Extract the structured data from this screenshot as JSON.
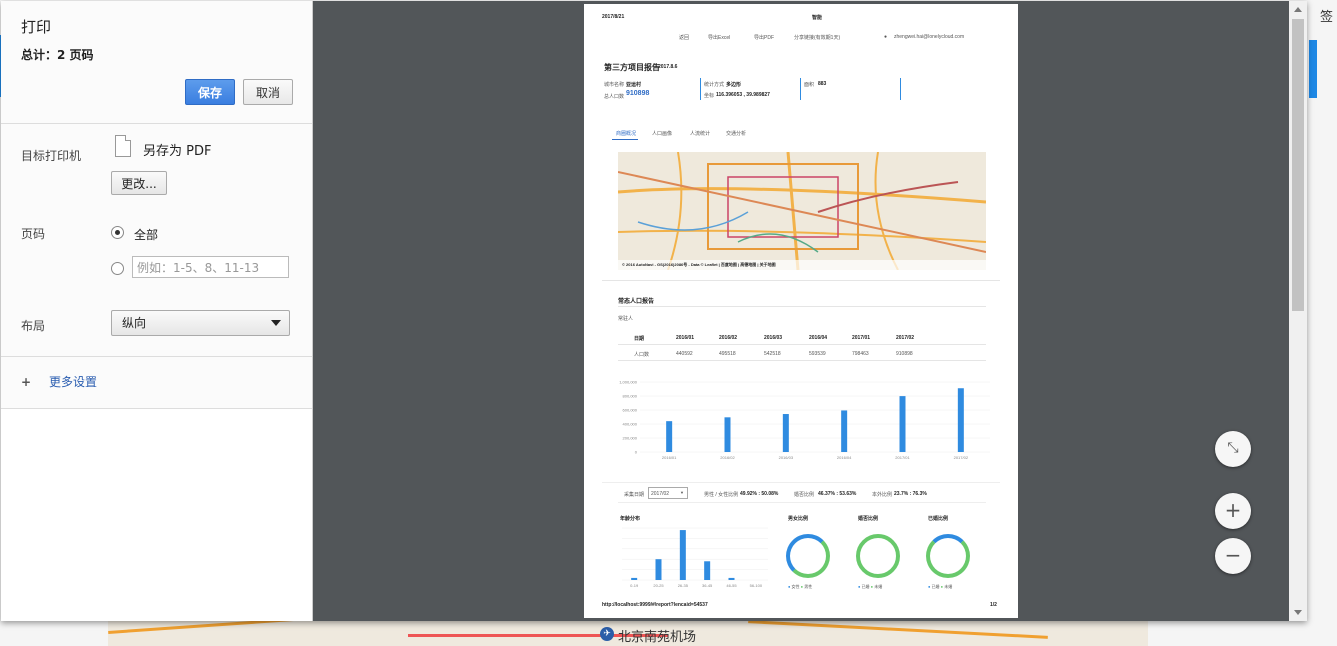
{
  "background": {
    "map_label": "北京南苑机场",
    "right_text": "签"
  },
  "dialog": {
    "title": "打印",
    "summary": "总计：2 页码",
    "save_label": "保存",
    "cancel_label": "取消",
    "destination_label": "目标打印机",
    "destination_value": "另存为 PDF",
    "change_label": "更改...",
    "pages_label": "页码",
    "pages_all": "全部",
    "pages_placeholder": "例如：1-5、8、11-13",
    "layout_label": "布局",
    "layout_value": "纵向",
    "more_settings": "更多设置"
  },
  "preview": {
    "header_date": "2017/8/21",
    "header_center": "智能",
    "nav": [
      "返回",
      "导出Excel",
      "导出PDF",
      "分享链接(有效期1天)"
    ],
    "user": "zhengwei.hai@lonelycloud.com",
    "report_title": "第三方项目报告",
    "report_date": "2017.8.6",
    "info": {
      "city_label": "城市名称",
      "city_value": "亚运村",
      "method_label": "统计方式",
      "method_value": "多边形",
      "area_label": "面积",
      "area_value": "883",
      "population_label": "总人口数",
      "population_value": "910898",
      "coords_label": "坐标",
      "coords_value": "116.396053 , 39.989827"
    },
    "tabs": [
      "商圈概况",
      "人口画像",
      "人流统计",
      "交通分析"
    ],
    "map_credit": "© 2016 AutoNavi - GS(2016)2086号 - Data © Leaflet | 百度地图 | 高德地图 | 关于地图",
    "section_title": "常态人口报告",
    "subsection": "常驻人",
    "table": {
      "headers": [
        "日期",
        "2016/01",
        "2016/02",
        "2016/03",
        "2016/04",
        "2017/01",
        "2017/02"
      ],
      "row_label": "人口数",
      "row_values": [
        "440592",
        "495518",
        "542518",
        "593539",
        "798463",
        "910898"
      ]
    },
    "filter": {
      "date_label": "采集日期",
      "date_value": "2017/02",
      "gender_label": "男性 / 女性比例",
      "gender_value": "49.92% : 50.08%",
      "marital_label": "婚否比例",
      "marital_value": "46.37% : 53.63%",
      "local_label": "本外比例",
      "local_value": "23.7% : 76.3%"
    },
    "mini_titles": [
      "年龄分布",
      "男女比例",
      "婚否比例",
      "已婚比例"
    ],
    "age_labels": [
      "0-19",
      "20-25",
      "26-35",
      "36-45",
      "46-55",
      "56-100"
    ],
    "donut_legends": [
      [
        "女性",
        "男性"
      ],
      [
        "已婚",
        "未婚"
      ],
      [
        "已婚",
        "未婚"
      ]
    ],
    "footer_url": "http://localhost:9999/#/report?lencaid=54537",
    "footer_page": "1/2"
  },
  "chart_data": {
    "type": "bar",
    "categories": [
      "2016/01",
      "2016/02",
      "2016/03",
      "2016/04",
      "2017/01",
      "2017/02"
    ],
    "values": [
      440592,
      495518,
      542518,
      593539,
      798463,
      910898
    ],
    "ylim": [
      0,
      1000000
    ],
    "yticks": [
      "0",
      "200,000",
      "400,000",
      "600,000",
      "800,000",
      "1,000,000"
    ],
    "color": "#2f8be0"
  },
  "age_chart_data": {
    "type": "bar",
    "categories": [
      "0-19",
      "20-25",
      "26-35",
      "36-45",
      "46-55",
      "56-100"
    ],
    "values": [
      2,
      20,
      48,
      18,
      2,
      0
    ]
  }
}
